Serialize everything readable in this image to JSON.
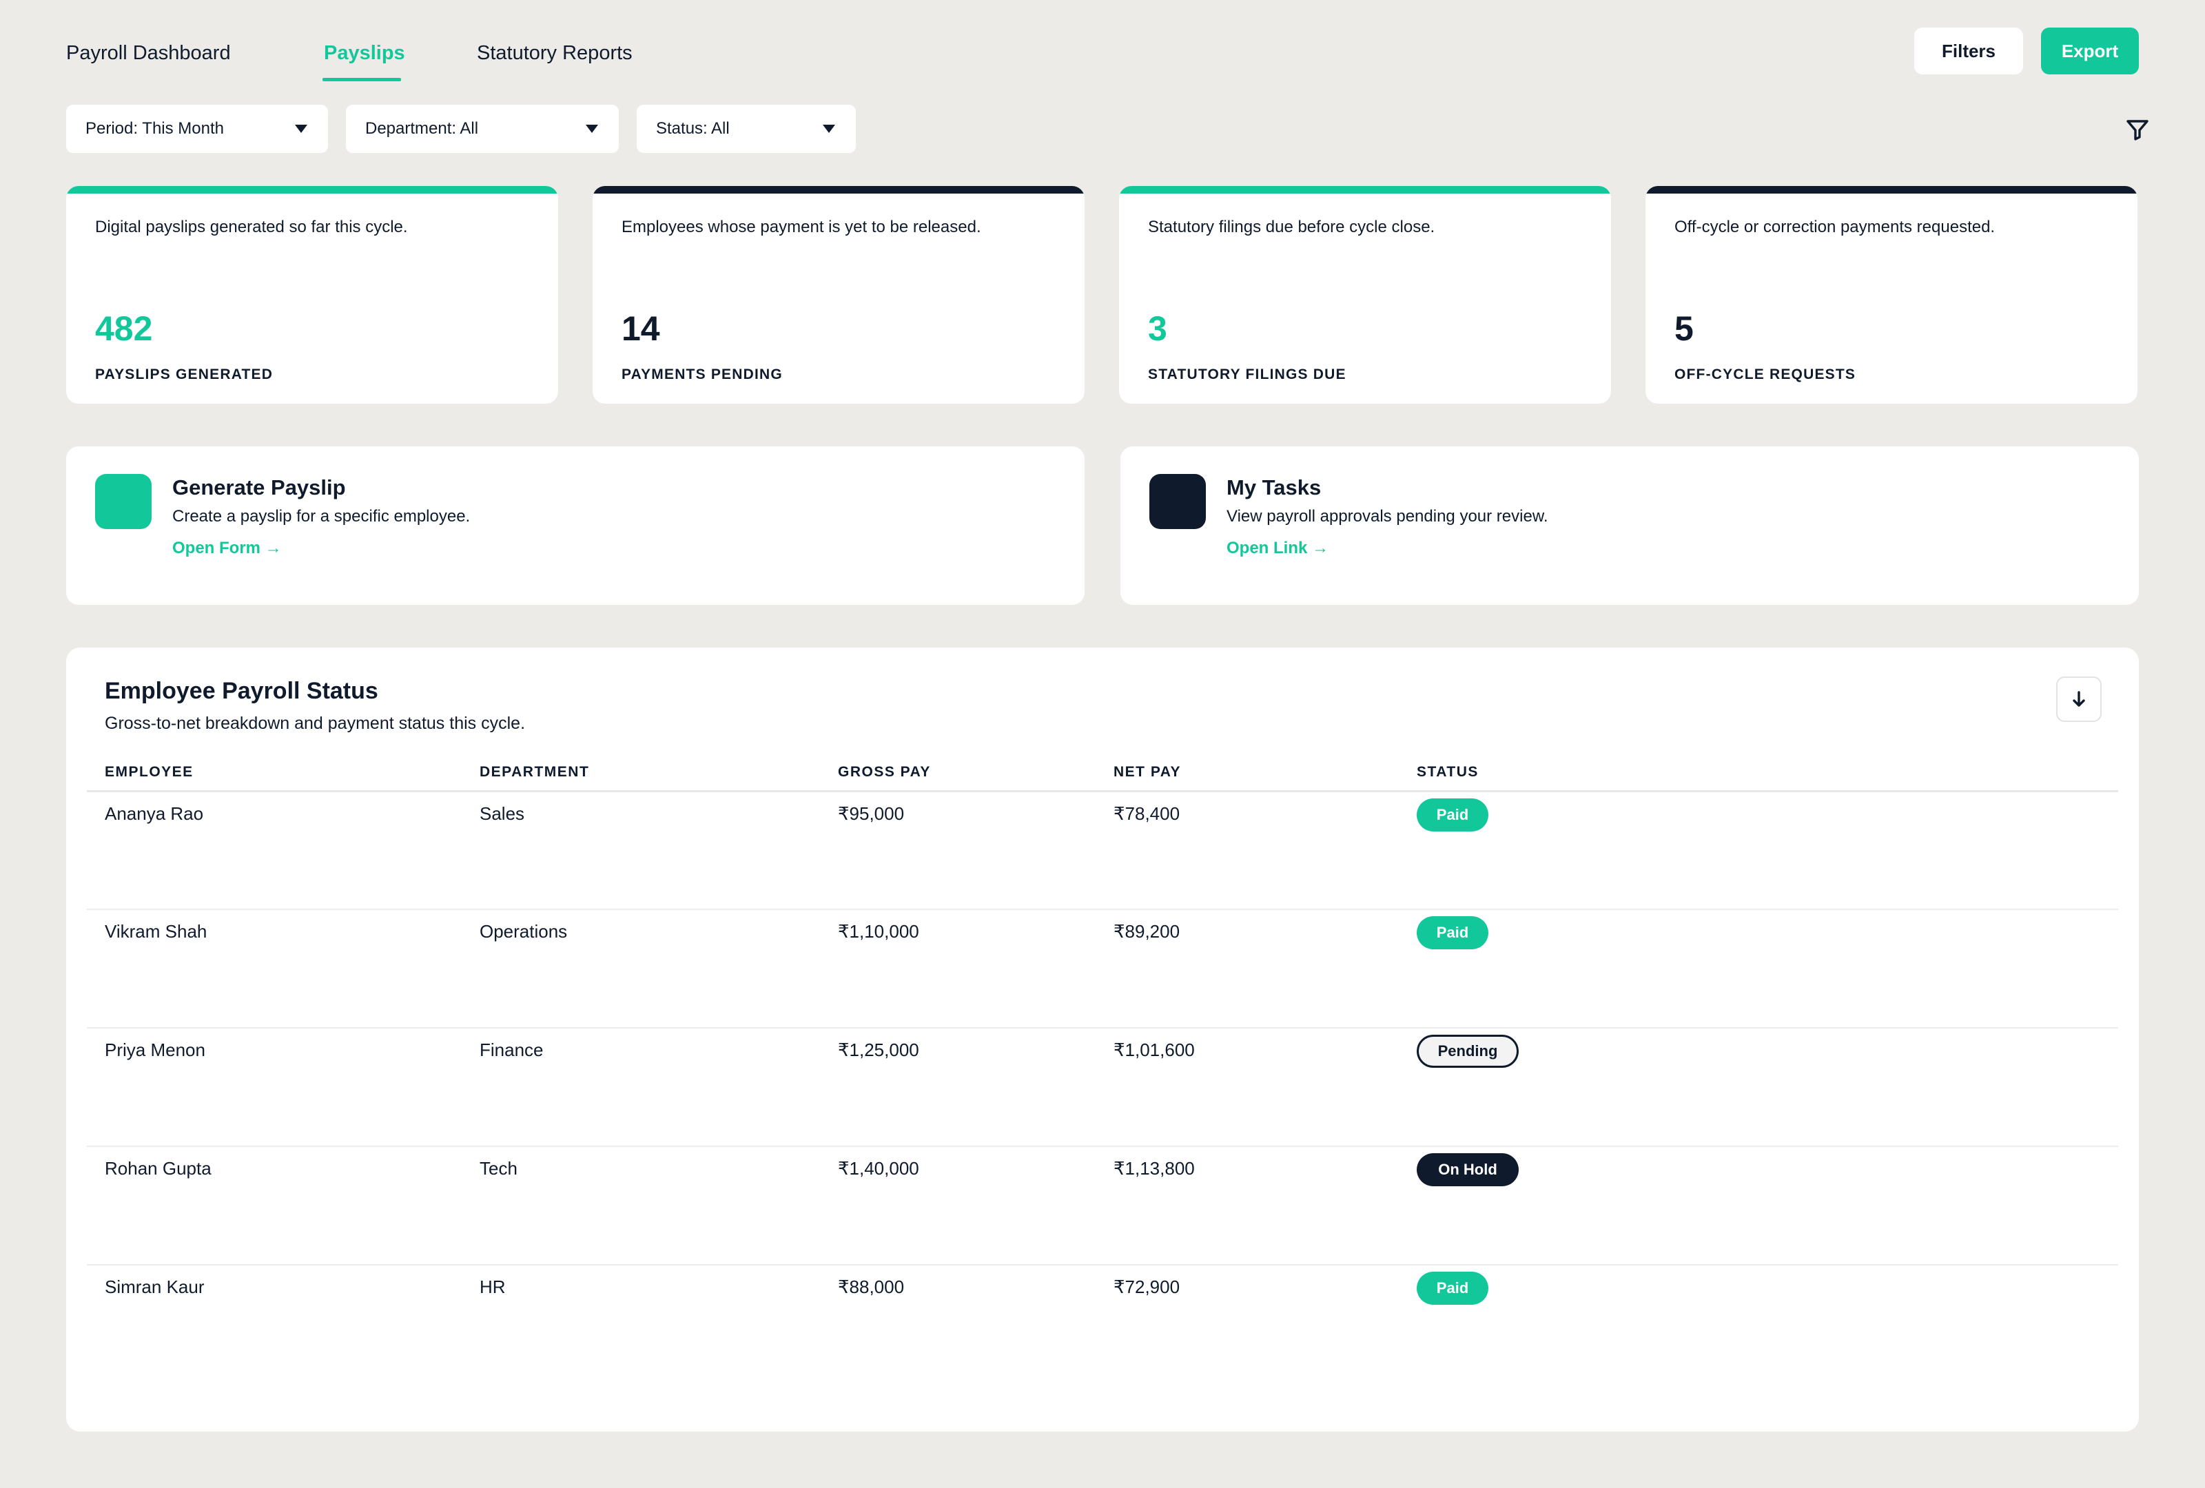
{
  "header": {
    "tabs": [
      {
        "label": "Payroll Dashboard",
        "active": false
      },
      {
        "label": "Payslips",
        "active": true
      },
      {
        "label": "Statutory Reports",
        "active": false
      }
    ],
    "filters_button": "Filters",
    "export_button": "Export"
  },
  "filters": {
    "period": "Period: This Month",
    "department": "Department: All",
    "status": "Status: All"
  },
  "kpis": [
    {
      "desc": "Digital payslips generated so far this cycle.",
      "value": "482",
      "label": "PAYSLIPS GENERATED",
      "color": "#12c79a"
    },
    {
      "desc": "Employees whose payment is yet to be released.",
      "value": "14",
      "label": "PAYMENTS PENDING",
      "color": "#0f1b2d"
    },
    {
      "desc": "Statutory filings due before cycle close.",
      "value": "3",
      "label": "STATUTORY FILINGS DUE",
      "color": "#12c79a"
    },
    {
      "desc": "Off-cycle or correction payments requested.",
      "value": "5",
      "label": "OFF-CYCLE REQUESTS",
      "color": "#0f1b2d"
    }
  ],
  "quick_actions": [
    {
      "title": "Generate Payslip",
      "desc": "Create a payslip for a specific employee.",
      "link": "Open Form →",
      "color": "#12c79a"
    },
    {
      "title": "My Tasks",
      "desc": "View payroll approvals pending your review.",
      "link": "Open Link →",
      "color": "#0f1b2d"
    }
  ],
  "table": {
    "title": "Employee Payroll Status",
    "subtitle": "Gross-to-net breakdown and payment status this cycle.",
    "columns": [
      "EMPLOYEE",
      "DEPARTMENT",
      "GROSS PAY",
      "NET PAY",
      "STATUS"
    ],
    "rows": [
      {
        "employee": "Ananya Rao",
        "department": "Sales",
        "gross": "₹95,000",
        "net": "₹78,400",
        "status": "Paid"
      },
      {
        "employee": "Vikram Shah",
        "department": "Operations",
        "gross": "₹1,10,000",
        "net": "₹89,200",
        "status": "Paid"
      },
      {
        "employee": "Priya Menon",
        "department": "Finance",
        "gross": "₹1,25,000",
        "net": "₹1,01,600",
        "status": "Pending"
      },
      {
        "employee": "Rohan Gupta",
        "department": "Tech",
        "gross": "₹1,40,000",
        "net": "₹1,13,800",
        "status": "On Hold"
      },
      {
        "employee": "Simran Kaur",
        "department": "HR",
        "gross": "₹88,000",
        "net": "₹72,900",
        "status": "Paid"
      }
    ]
  },
  "colors": {
    "accent": "#12c79a",
    "navy": "#0f1b2d",
    "background": "#edebe7"
  }
}
